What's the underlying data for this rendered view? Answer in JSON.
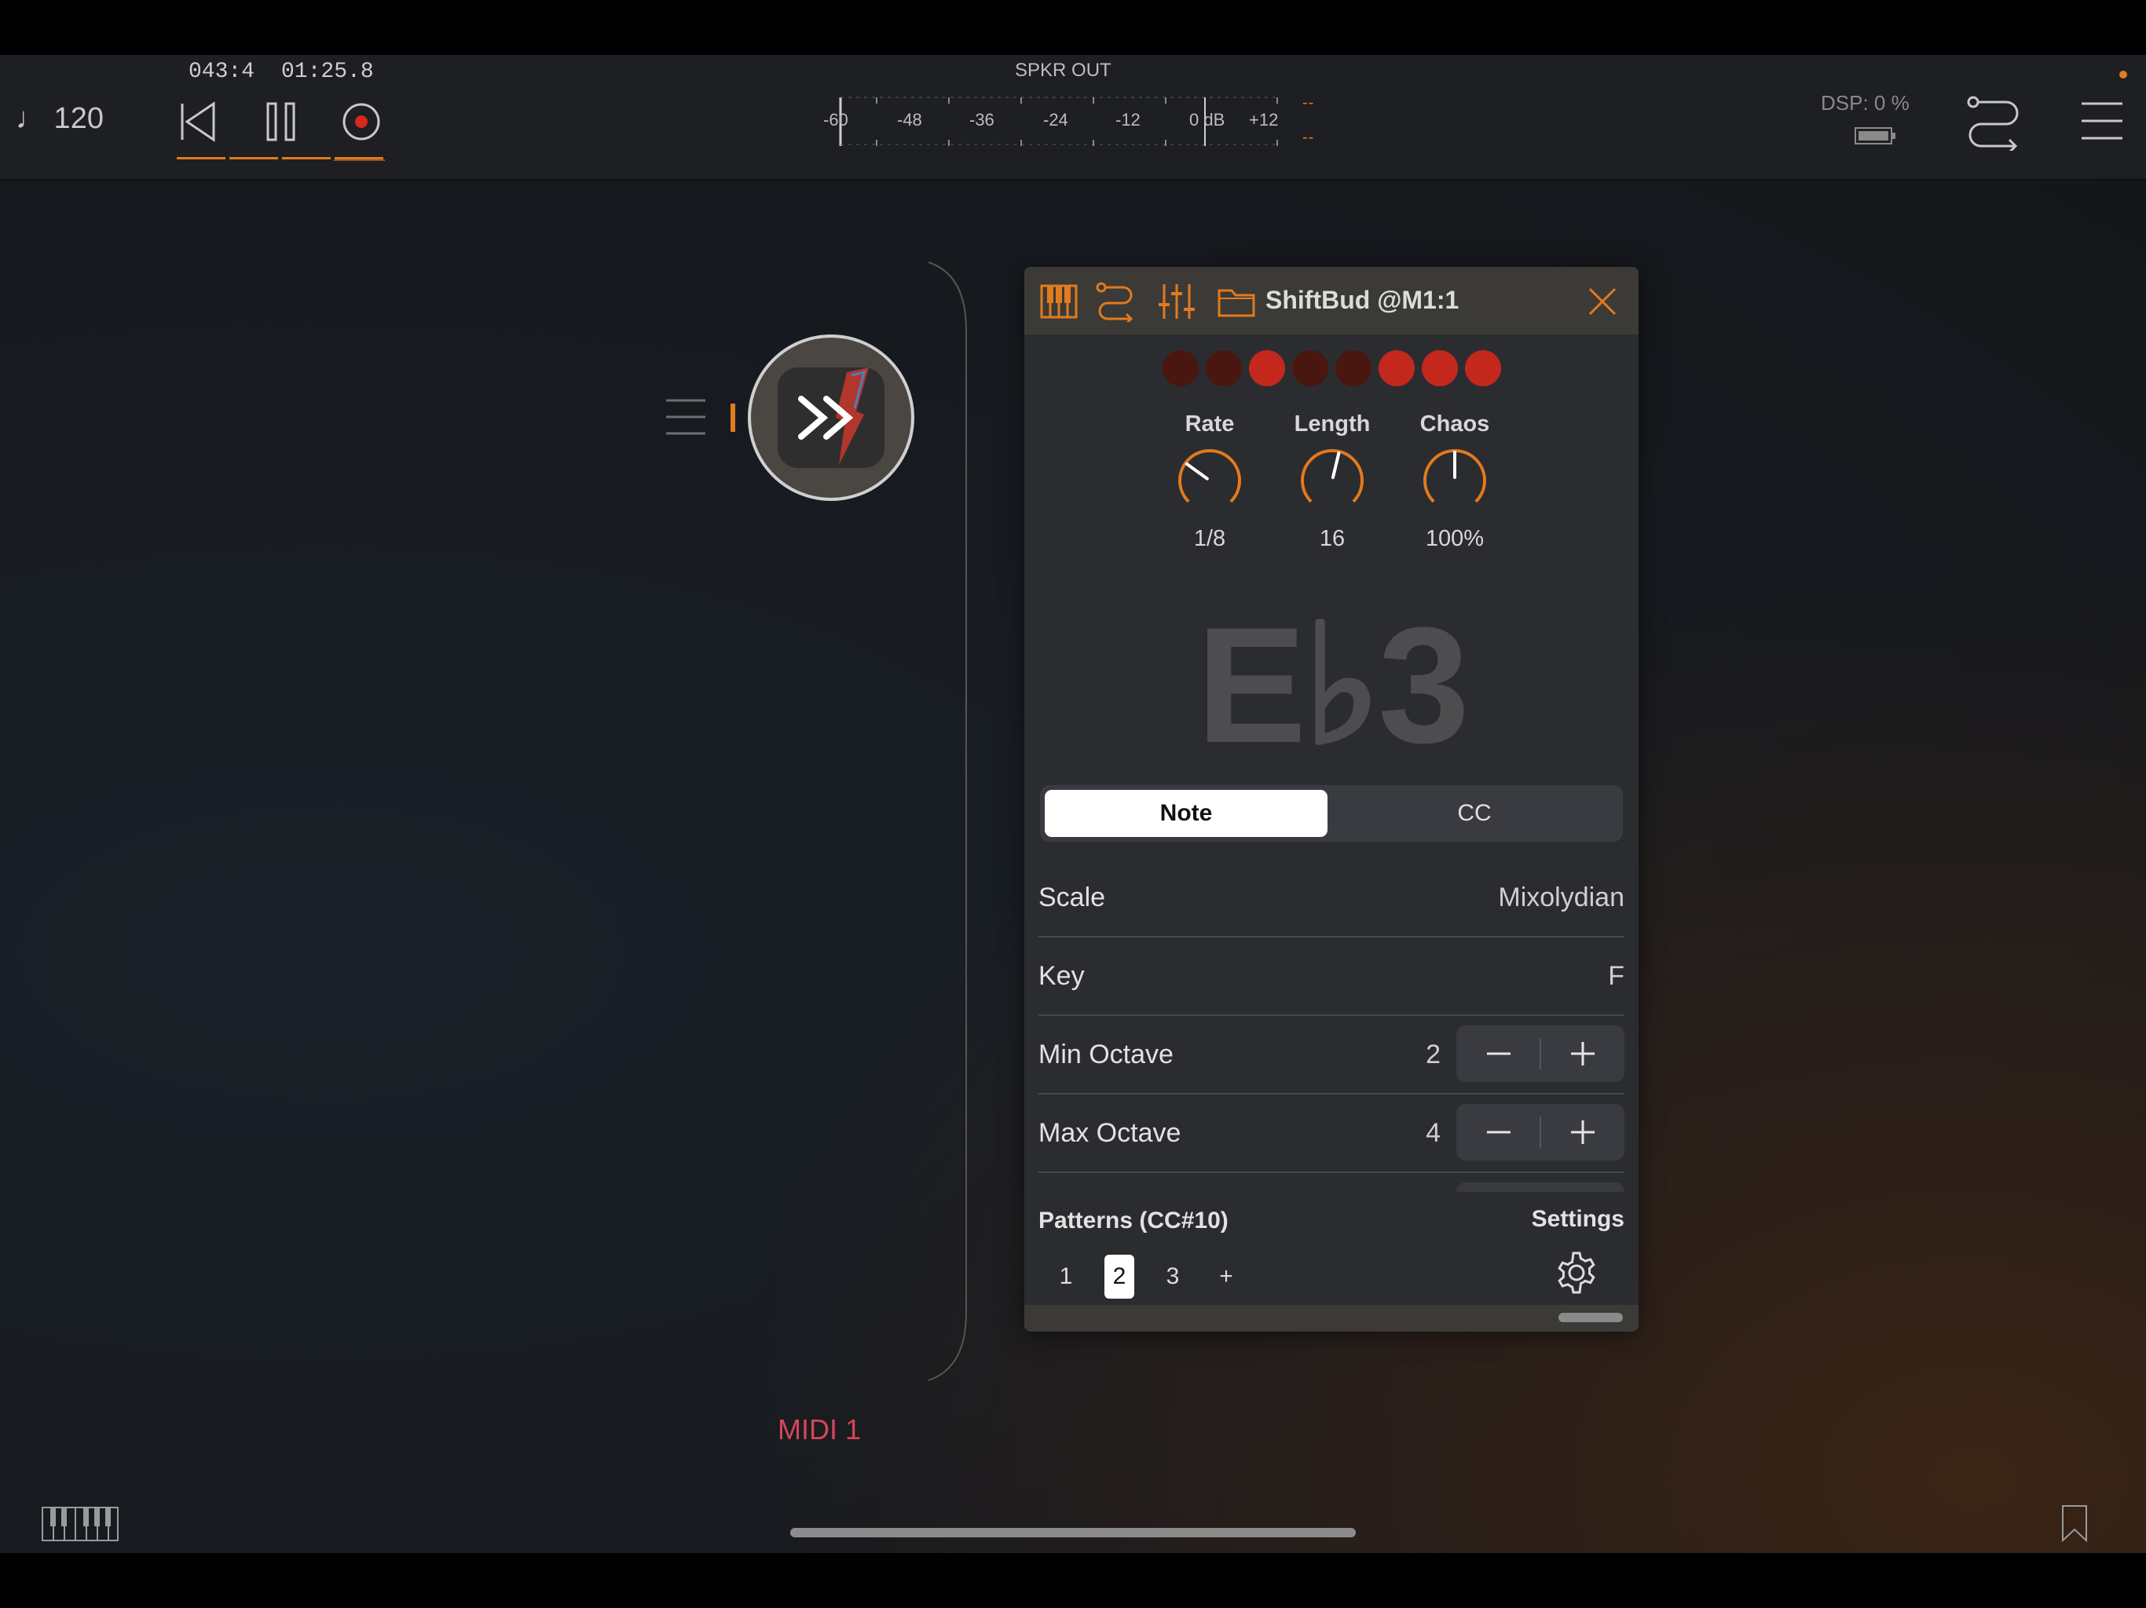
{
  "transport": {
    "tempo": "♩ 120",
    "bar_position": "043:4",
    "time": "01:25.8"
  },
  "meter": {
    "title": "SPKR OUT",
    "ticks": [
      "-60",
      "-48",
      "-36",
      "-24",
      "-12",
      "0 dB",
      "+12"
    ],
    "peak_top": "--",
    "peak_bottom": "--"
  },
  "status": {
    "dsp": "DSP:  0 %"
  },
  "track": {
    "midi_label": "MIDI 1"
  },
  "plugin": {
    "title": "ShiftBud @M1:1",
    "pattern_dots": [
      "#4a1610",
      "#4a1610",
      "#c4281c",
      "#4a1610",
      "#4a1610",
      "#c4281c",
      "#c4281c",
      "#c4281c"
    ],
    "knobs": [
      {
        "label": "Rate",
        "value": "1/8",
        "level": 0.3
      },
      {
        "label": "Length",
        "value": "16",
        "level": 0.55
      },
      {
        "label": "Chaos",
        "value": "100%",
        "level": 0.5
      }
    ],
    "current_note": "E♭3",
    "mode": {
      "selected": "Note",
      "other": "CC"
    },
    "rows": {
      "scale_label": "Scale",
      "scale_value": "Mixolydian",
      "key_label": "Key",
      "key_value": "F",
      "min_octave_label": "Min Octave",
      "min_octave_value": "2",
      "max_octave_label": "Max Octave",
      "max_octave_value": "4"
    },
    "patterns_label": "Patterns (CC#10)",
    "patterns": [
      "1",
      "2",
      "3",
      "+"
    ],
    "selected_pattern": "2",
    "settings_label": "Settings"
  },
  "colors": {
    "accent": "#e27a1e",
    "record": "#d9271c",
    "midi": "#d6455a"
  }
}
